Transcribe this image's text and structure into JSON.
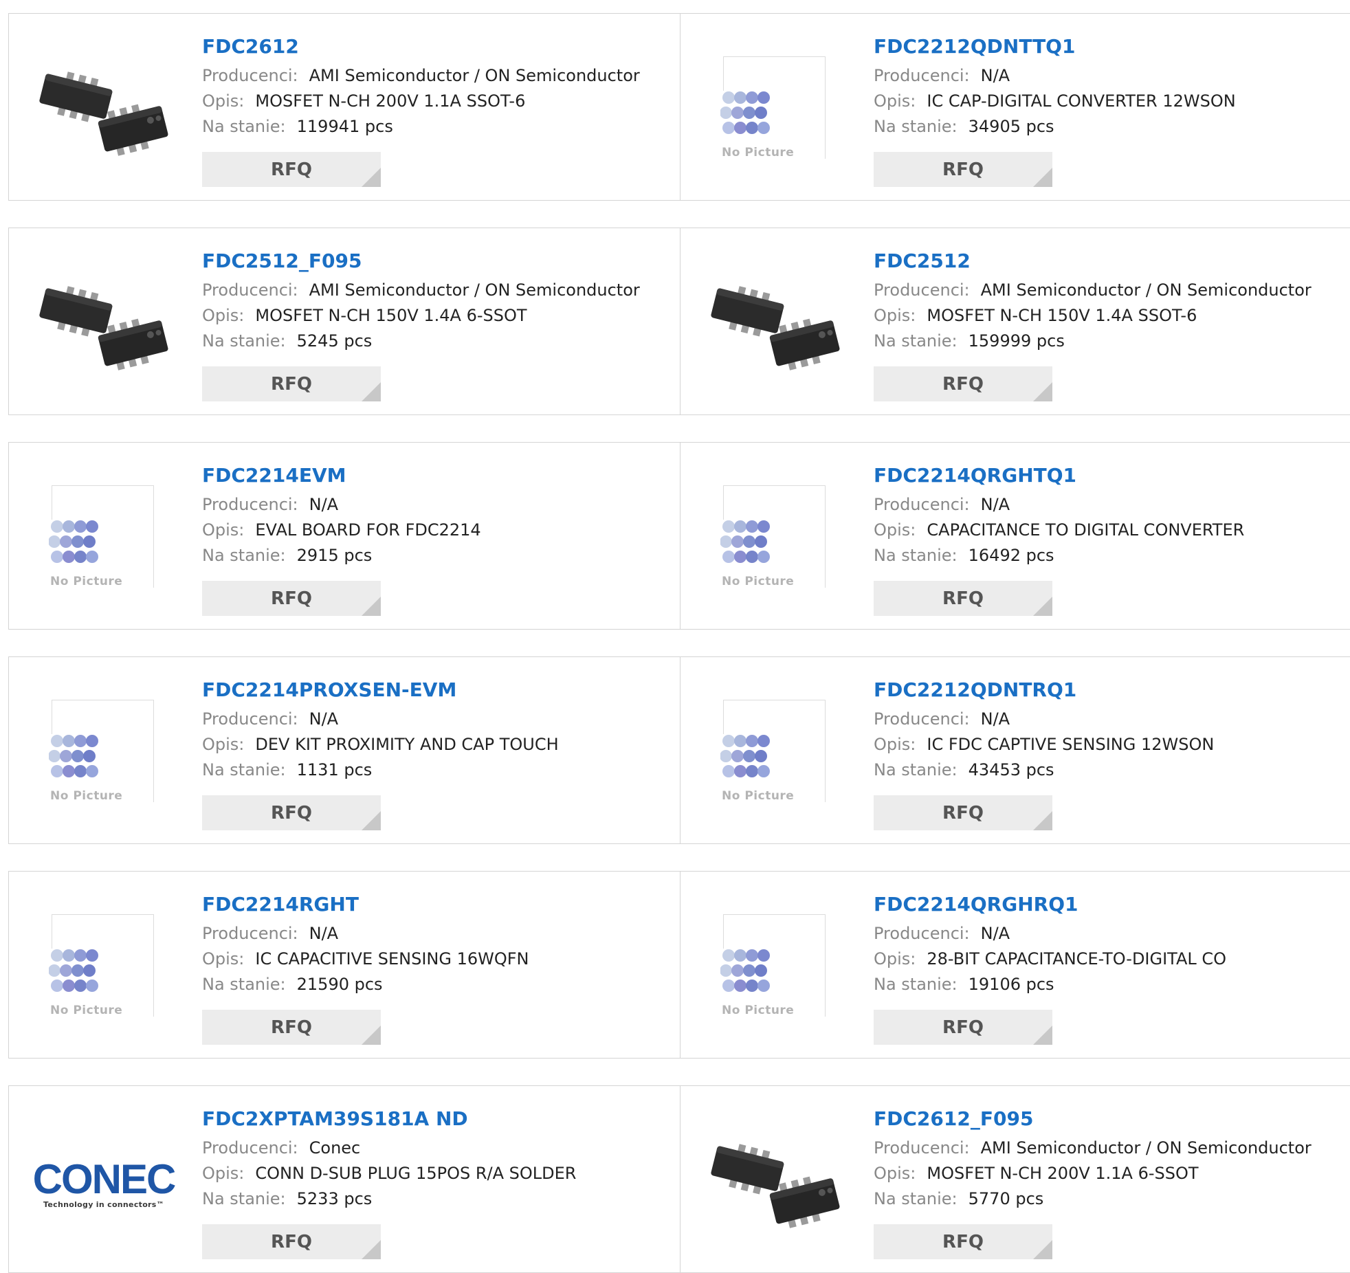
{
  "labels": {
    "manufacturer": "Producenci:",
    "description": "Opis:",
    "stock": "Na stanie:",
    "rfq": "RFQ",
    "no_picture": "No Picture"
  },
  "products": [
    {
      "pn": "FDC2612",
      "manufacturer": "AMI Semiconductor / ON Semiconductor",
      "description": "MOSFET N-CH 200V 1.1A SSOT-6",
      "stock": "119941 pcs",
      "image": "chip"
    },
    {
      "pn": "FDC2212QDNTTQ1",
      "manufacturer": "N/A",
      "description": "IC CAP-DIGITAL CONVERTER 12WSON",
      "stock": "34905 pcs",
      "image": "none"
    },
    {
      "pn": "FDC2512_F095",
      "manufacturer": "AMI Semiconductor / ON Semiconductor",
      "description": "MOSFET N-CH 150V 1.4A 6-SSOT",
      "stock": "5245 pcs",
      "image": "chip"
    },
    {
      "pn": "FDC2512",
      "manufacturer": "AMI Semiconductor / ON Semiconductor",
      "description": "MOSFET N-CH 150V 1.4A SSOT-6",
      "stock": "159999 pcs",
      "image": "chip"
    },
    {
      "pn": "FDC2214EVM",
      "manufacturer": "N/A",
      "description": "EVAL BOARD FOR FDC2214",
      "stock": "2915 pcs",
      "image": "none"
    },
    {
      "pn": "FDC2214QRGHTQ1",
      "manufacturer": "N/A",
      "description": "CAPACITANCE TO DIGITAL CONVERTER",
      "stock": "16492 pcs",
      "image": "none"
    },
    {
      "pn": "FDC2214PROXSEN-EVM",
      "manufacturer": "N/A",
      "description": "DEV KIT PROXIMITY AND CAP TOUCH",
      "stock": "1131 pcs",
      "image": "none"
    },
    {
      "pn": "FDC2212QDNTRQ1",
      "manufacturer": "N/A",
      "description": "IC FDC CAPTIVE SENSING 12WSON",
      "stock": "43453 pcs",
      "image": "none"
    },
    {
      "pn": "FDC2214RGHT",
      "manufacturer": "N/A",
      "description": "IC CAPACITIVE SENSING 16WQFN",
      "stock": "21590 pcs",
      "image": "none"
    },
    {
      "pn": "FDC2214QRGHRQ1",
      "manufacturer": "N/A",
      "description": "28-BIT CAPACITANCE-TO-DIGITAL CO",
      "stock": "19106 pcs",
      "image": "none"
    },
    {
      "pn": "FDC2XPTAM39S181A ND",
      "manufacturer": "Conec",
      "description": "CONN D-SUB PLUG 15POS R/A SOLDER",
      "stock": "5233 pcs",
      "image": "conec",
      "logo": {
        "brand": "CONEC",
        "tagline": "Technology in connectors™"
      }
    },
    {
      "pn": "FDC2612_F095",
      "manufacturer": "AMI Semiconductor / ON Semiconductor",
      "description": "MOSFET N-CH 200V 1.1A 6-SSOT",
      "stock": "5770 pcs",
      "image": "chip"
    }
  ],
  "colors": {
    "link": "#1a6fc4",
    "label": "#888888",
    "border": "#d4d4d4",
    "button_bg": "#ececec"
  }
}
